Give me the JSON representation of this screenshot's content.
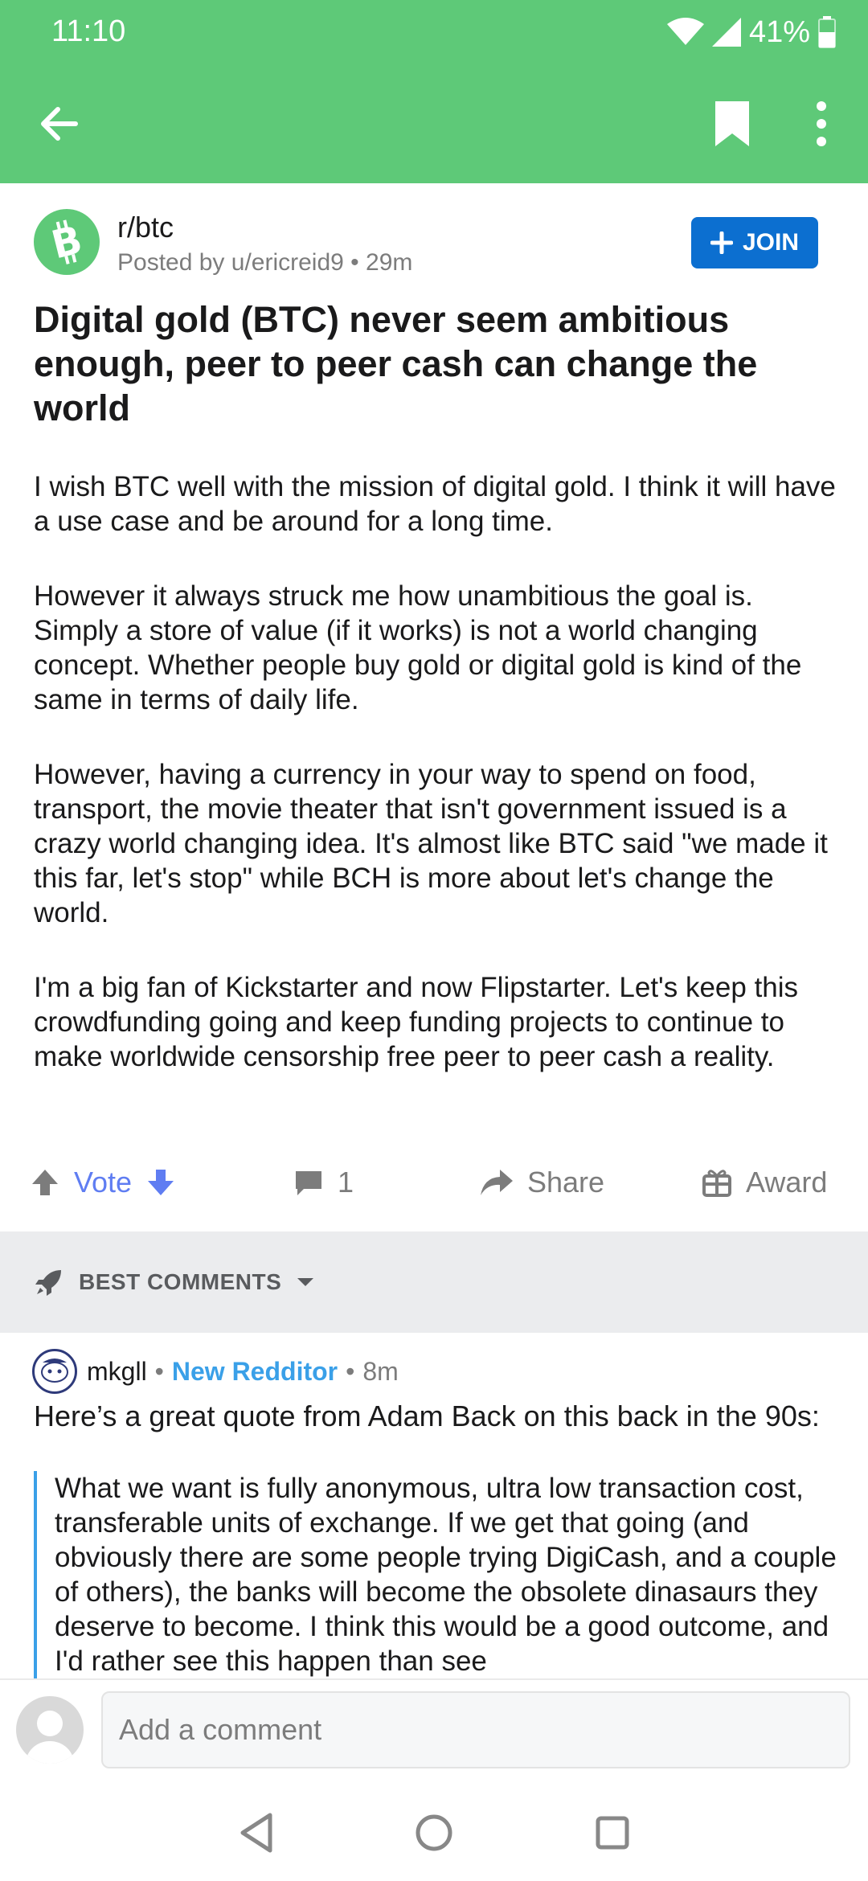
{
  "status": {
    "time": "11:10",
    "battery": "41%"
  },
  "appbar": {
    "icons": [
      "back-arrow-icon",
      "bookmark-icon",
      "more-vertical-icon"
    ]
  },
  "post": {
    "subreddit": "r/btc",
    "posted_prefix": "Posted by u/ericreid9",
    "dot": "•",
    "age": "29m",
    "join_label": "JOIN",
    "title": "Digital gold (BTC) never seem ambitious enough, peer to peer cash can change the world",
    "body": [
      "I wish BTC well with the mission of digital gold. I think it will have a use case and be around for a long time.",
      "However it always struck me how unambitious the goal is. Simply a store of value (if it works) is not a world changing concept. Whether people buy gold or digital gold is kind of the same in terms of daily life.",
      "However, having a currency in your way to spend on food, transport, the movie theater that isn't government issued is a crazy world changing idea. It's almost like BTC said \"we made it this far, let's stop\" while BCH is more about let's change the world.",
      "I'm a big fan of Kickstarter and now Flipstarter. Let's keep this crowdfunding going and keep funding  projects to continue to make worldwide censorship free peer to peer cash a reality."
    ],
    "vote_label": "Vote",
    "comment_count": "1",
    "share_label": "Share",
    "award_label": "Award"
  },
  "sort": {
    "label": "BEST COMMENTS"
  },
  "comment": {
    "author": "mkgll",
    "dot": "•",
    "flair": "New Redditor",
    "age": "8m",
    "text": "Here’s a great quote from Adam Back on this back in the 90s:",
    "quote": "What we want is fully anonymous, ultra low transaction cost, transferable units of exchange.  If we get that going (and obviously there are some people trying DigiCash, and a couple of others), the banks will become the obsolete dinasaurs they deserve to become.  I think this would be a good outcome, and I'd rather see this happen than see"
  },
  "composer": {
    "placeholder": "Add a comment"
  },
  "colors": {
    "header_green": "#5ec978",
    "join_blue": "#0c6fd0",
    "vote_blue": "#5f7df2",
    "flair_blue": "#3aa0e8"
  }
}
